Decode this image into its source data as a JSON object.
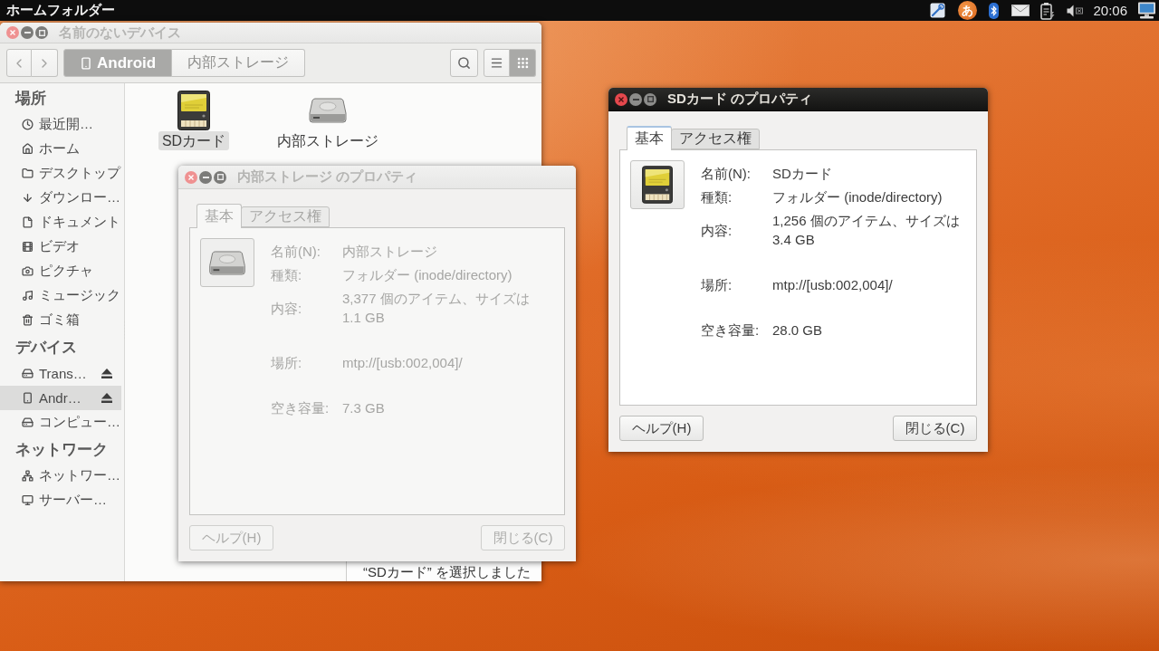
{
  "top_panel": {
    "app_title": "ホームフォルダー",
    "input_method": "あ",
    "clock": "20:06"
  },
  "file_manager": {
    "title": "名前のないデバイス",
    "active": false,
    "path": [
      {
        "label": "Android",
        "kind": "device",
        "selected": true
      },
      {
        "label": "内部ストレージ",
        "kind": "folder",
        "selected": false
      }
    ],
    "view_modes": [
      {
        "kind": "list",
        "selected": false
      },
      {
        "kind": "grid",
        "selected": true
      }
    ],
    "sidebar": [
      {
        "heading": "場所",
        "items": [
          {
            "label": "最近開…",
            "kind": "recent",
            "selected": false,
            "ejectable": false
          },
          {
            "label": "ホーム",
            "kind": "home",
            "selected": false,
            "ejectable": false
          },
          {
            "label": "デスクトップ",
            "kind": "desktop",
            "selected": false,
            "ejectable": false
          },
          {
            "label": "ダウンロー…",
            "kind": "downloads",
            "selected": false,
            "ejectable": false
          },
          {
            "label": "ドキュメント",
            "kind": "documents",
            "selected": false,
            "ejectable": false
          },
          {
            "label": "ビデオ",
            "kind": "videos",
            "selected": false,
            "ejectable": false
          },
          {
            "label": "ピクチャ",
            "kind": "pictures",
            "selected": false,
            "ejectable": false
          },
          {
            "label": "ミュージック",
            "kind": "music",
            "selected": false,
            "ejectable": false
          },
          {
            "label": "ゴミ箱",
            "kind": "trash",
            "selected": false,
            "ejectable": false
          }
        ]
      },
      {
        "heading": "デバイス",
        "items": [
          {
            "label": "Trans…",
            "kind": "drive",
            "selected": false,
            "ejectable": true
          },
          {
            "label": "Andr…",
            "kind": "phone",
            "selected": true,
            "ejectable": true
          },
          {
            "label": "コンピュー…",
            "kind": "computer",
            "selected": false,
            "ejectable": false
          }
        ]
      },
      {
        "heading": "ネットワーク",
        "items": [
          {
            "label": "ネットワー…",
            "kind": "network",
            "selected": false,
            "ejectable": false
          },
          {
            "label": "サーバー…",
            "kind": "server",
            "selected": false,
            "ejectable": false
          }
        ]
      }
    ],
    "items": [
      {
        "label": "SDカード",
        "kind": "sdcard",
        "selected": true
      },
      {
        "label": "内部ストレージ",
        "kind": "storage",
        "selected": false
      }
    ],
    "status": "“SDカード” を選択しました"
  },
  "dialogs": [
    {
      "title": "内部ストレージ のプロパティ",
      "active": false,
      "kind": "storage",
      "tabs": [
        {
          "label": "基本",
          "selected": true
        },
        {
          "label": "アクセス権",
          "selected": false
        }
      ],
      "sections": [
        {
          "fields": [
            {
              "label": "名前(N):",
              "value": "内部ストレージ"
            },
            {
              "label": "種類:",
              "value": "フォルダー (inode/directory)"
            },
            {
              "label": "内容:",
              "value": "3,377 個のアイテム、サイズは 1.1 GB"
            }
          ]
        },
        {
          "fields": [
            {
              "label": "場所:",
              "value": "mtp://[usb:002,004]/"
            }
          ]
        },
        {
          "fields": [
            {
              "label": "空き容量:",
              "value": "7.3 GB"
            }
          ]
        }
      ],
      "buttons": [
        "ヘルプ(H)",
        "閉じる(C)"
      ]
    },
    {
      "title": "SDカード のプロパティ",
      "active": true,
      "kind": "sdcard",
      "tabs": [
        {
          "label": "基本",
          "selected": true
        },
        {
          "label": "アクセス権",
          "selected": false
        }
      ],
      "sections": [
        {
          "fields": [
            {
              "label": "名前(N):",
              "value": "SDカード"
            },
            {
              "label": "種類:",
              "value": "フォルダー (inode/directory)"
            },
            {
              "label": "内容:",
              "value": "1,256 個のアイテム、サイズは 3.4 GB"
            }
          ]
        },
        {
          "fields": [
            {
              "label": "場所:",
              "value": "mtp://[usb:002,004]/"
            }
          ]
        },
        {
          "fields": [
            {
              "label": "空き容量:",
              "value": "28.0 GB"
            }
          ]
        }
      ],
      "buttons": [
        "ヘルプ(H)",
        "閉じる(C)"
      ]
    }
  ]
}
